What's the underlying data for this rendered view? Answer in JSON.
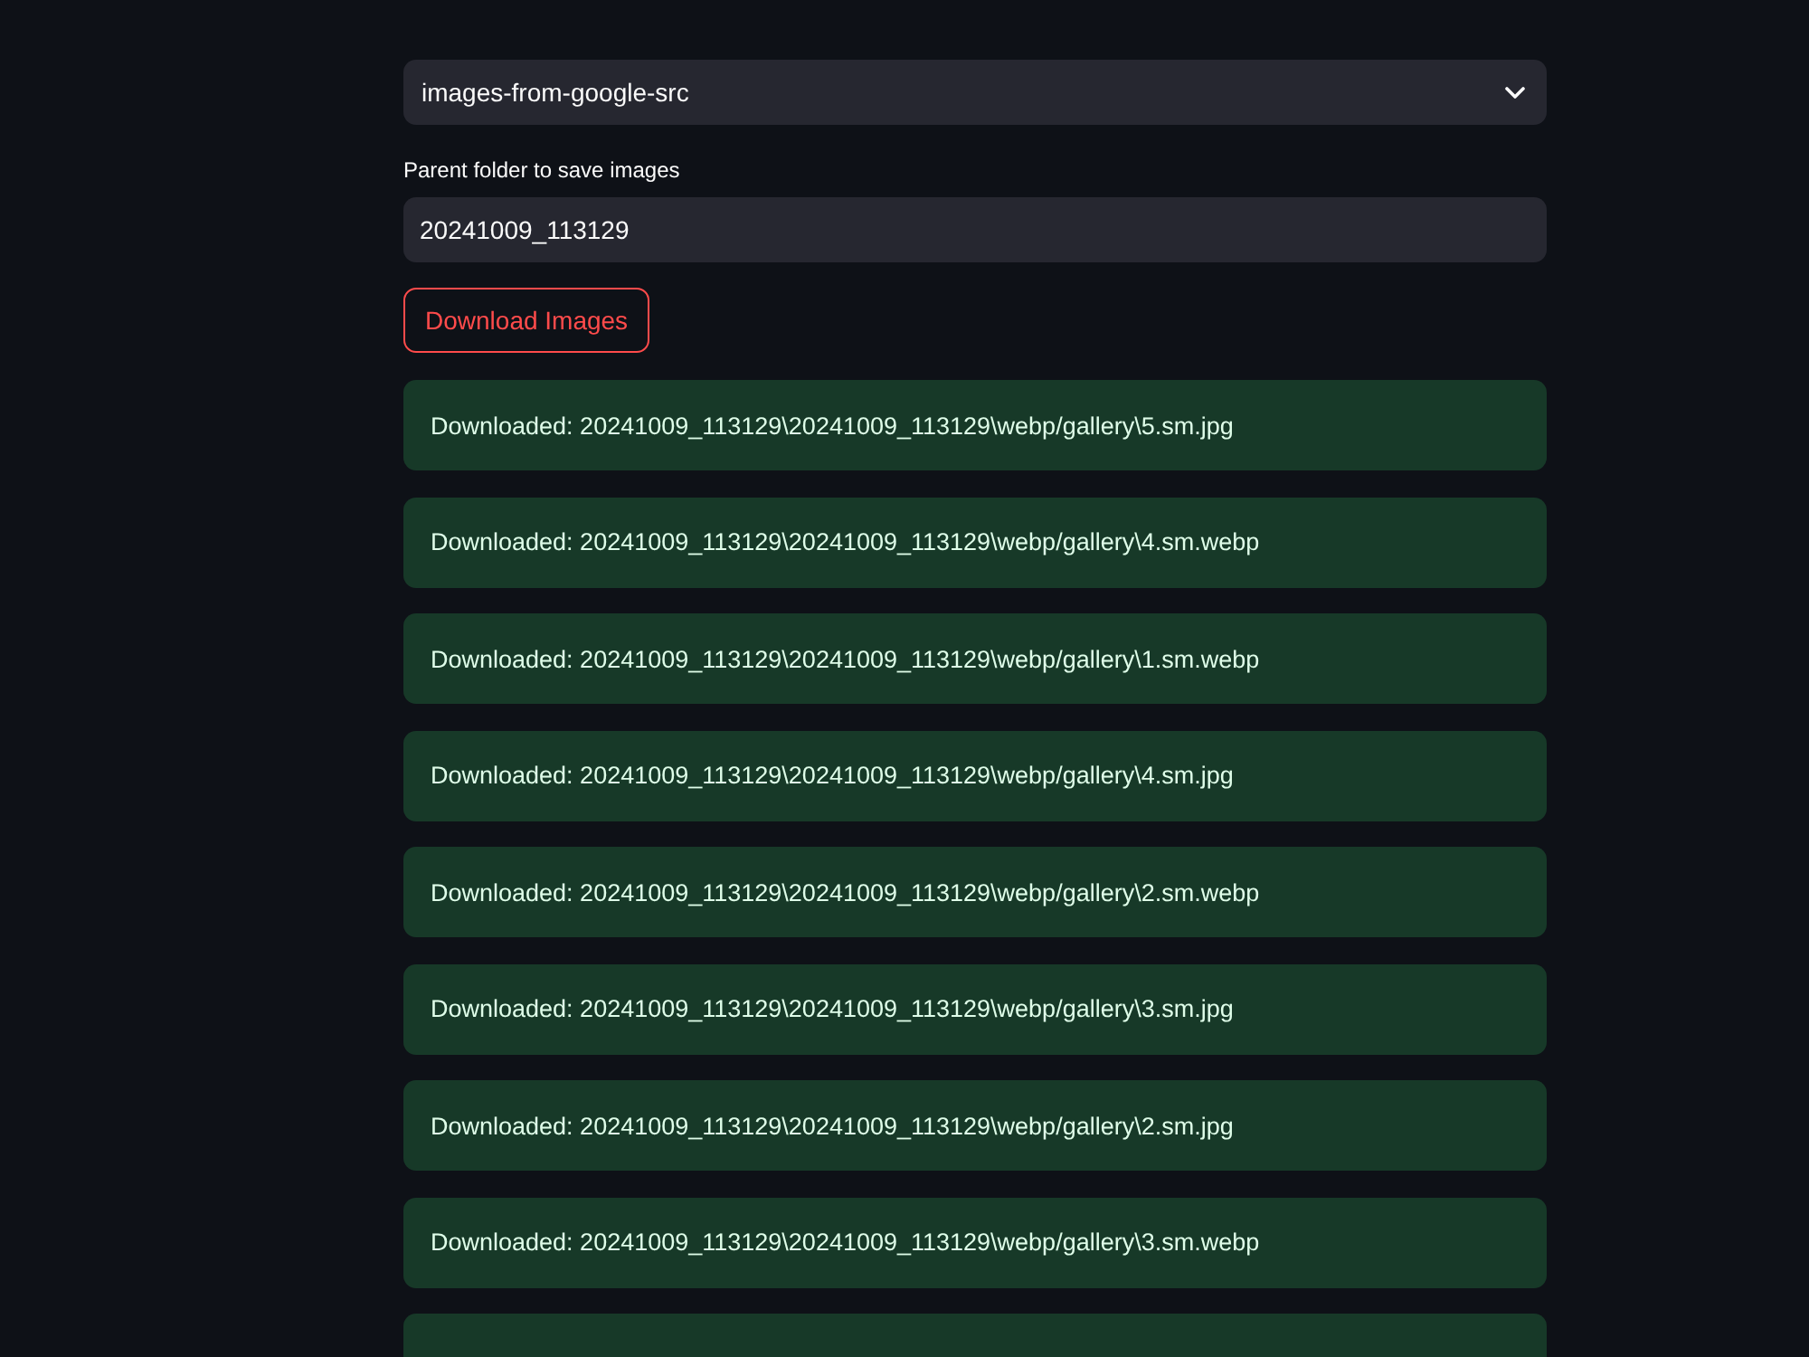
{
  "source_select": {
    "value": "images-from-google-src"
  },
  "parent_folder": {
    "label": "Parent folder to save images",
    "value": "20241009_113129"
  },
  "download_button": {
    "label": "Download Images"
  },
  "messages": [
    "Downloaded: 20241009_113129\\20241009_113129\\webp/gallery\\5.sm.jpg",
    "Downloaded: 20241009_113129\\20241009_113129\\webp/gallery\\4.sm.webp",
    "Downloaded: 20241009_113129\\20241009_113129\\webp/gallery\\1.sm.webp",
    "Downloaded: 20241009_113129\\20241009_113129\\webp/gallery\\4.sm.jpg",
    "Downloaded: 20241009_113129\\20241009_113129\\webp/gallery\\2.sm.webp",
    "Downloaded: 20241009_113129\\20241009_113129\\webp/gallery\\3.sm.jpg",
    "Downloaded: 20241009_113129\\20241009_113129\\webp/gallery\\2.sm.jpg",
    "Downloaded: 20241009_113129\\20241009_113129\\webp/gallery\\3.sm.webp"
  ],
  "more_messages_below": true
}
